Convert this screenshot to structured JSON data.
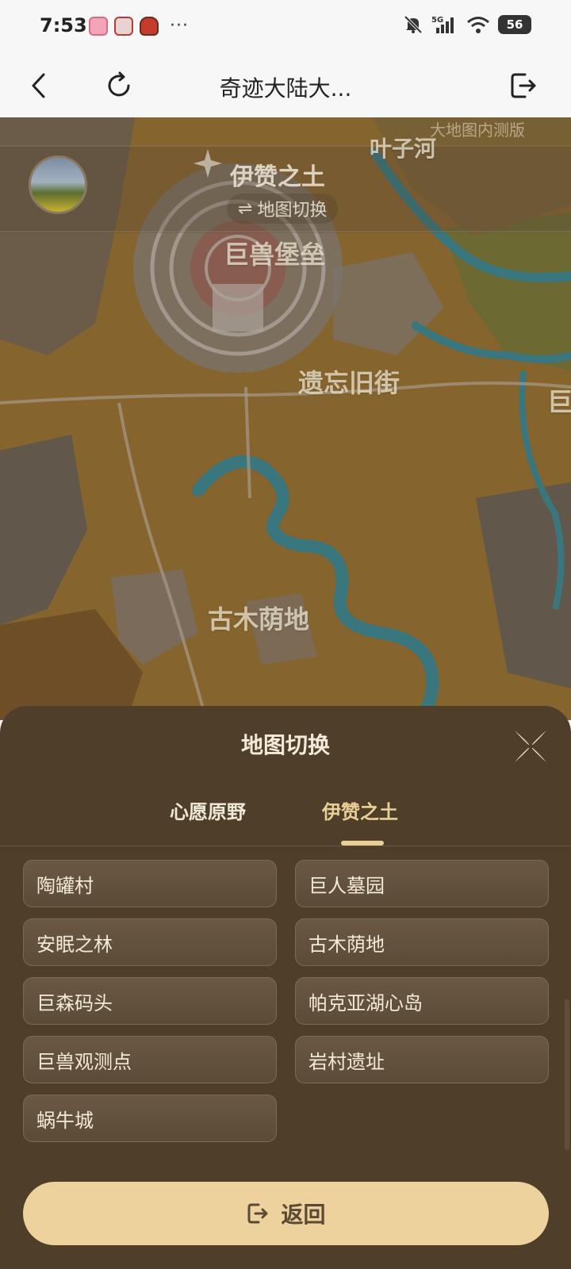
{
  "status_bar": {
    "time": "7:53",
    "dots": "···",
    "battery": "56"
  },
  "header": {
    "title": "奇迹大陆大..."
  },
  "map": {
    "beta_tag": "大地图内测版",
    "region_title": "伊赞之土",
    "switch_label": "地图切换",
    "labels": {
      "yezihe": "叶子河",
      "jushou_baolei": "巨兽堡垒",
      "yiwang_jiujie": "遗忘旧街",
      "gumu_yindi": "古木荫地",
      "edge": "巨"
    }
  },
  "sheet": {
    "title": "地图切换",
    "tabs": [
      {
        "label": "心愿原野",
        "active": false
      },
      {
        "label": "伊赞之土",
        "active": true
      }
    ],
    "locations": [
      "陶罐村",
      "巨人墓园",
      "安眠之林",
      "古木荫地",
      "巨森码头",
      "帕克亚湖心岛",
      "巨兽观测点",
      "岩村遗址",
      "蜗牛城"
    ],
    "back_label": "返回"
  },
  "colors": {
    "sheet_bg": "#4f3f2a",
    "accent": "#e9cf98",
    "back_button": "#eed29d"
  }
}
